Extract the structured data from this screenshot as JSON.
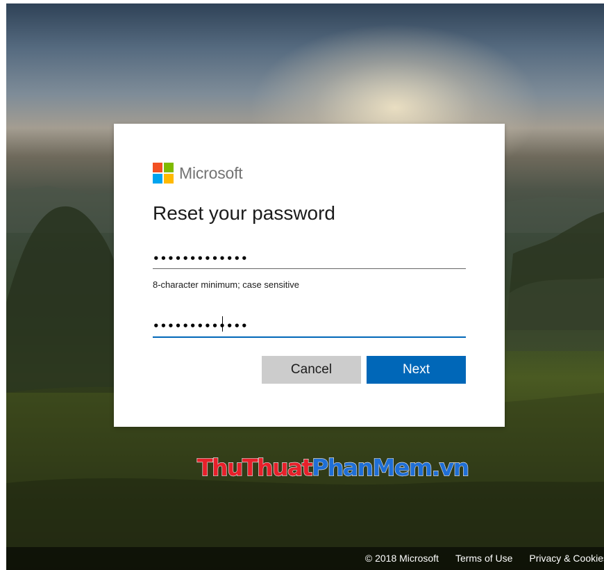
{
  "brand": {
    "name": "Microsoft",
    "logo_colors": [
      "#f25022",
      "#7fba00",
      "#00a4ef",
      "#ffb900"
    ]
  },
  "dialog": {
    "title": "Reset your password",
    "new_password_value": "•••••••••••••",
    "hint": "8-character minimum; case sensitive",
    "confirm_password_value": "•••••••••••••",
    "cancel_label": "Cancel",
    "next_label": "Next",
    "accent_color": "#0067b8"
  },
  "watermark": {
    "parts": [
      "Thu",
      "Thuat",
      "Phan",
      "Mem",
      ".vn"
    ]
  },
  "footer": {
    "copyright": "© 2018 Microsoft",
    "terms": "Terms of Use",
    "privacy": "Privacy & Cookies"
  }
}
